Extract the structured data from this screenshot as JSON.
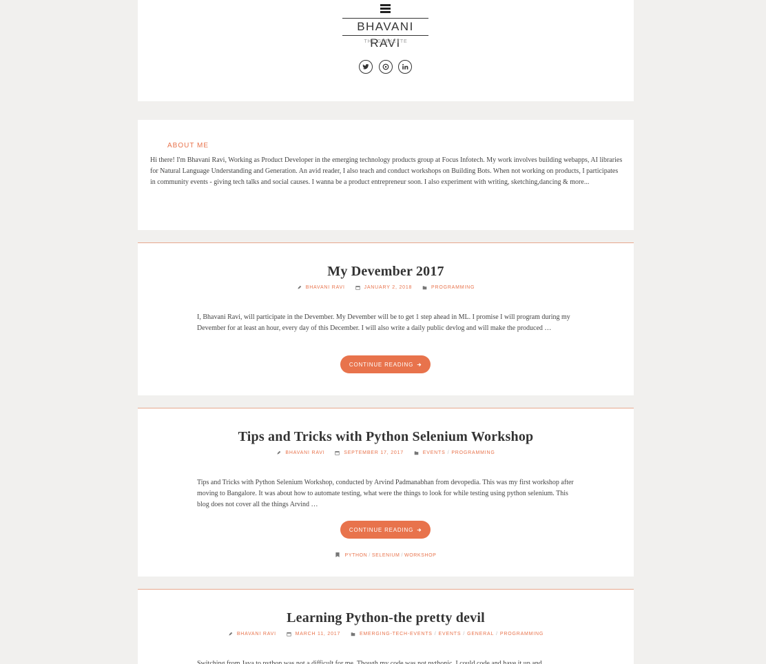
{
  "site": {
    "title": "BHAVANI RAVI",
    "tagline": "THE GEEKETTE",
    "social": [
      "twitter-icon",
      "dribbble-icon",
      "linkedin-icon"
    ]
  },
  "about": {
    "title": "ABOUT ME",
    "text": "Hi there! I'm Bhavani Ravi, Working as Product Developer in the emerging technology products group at Focus Infotech. My work involves building webapps, AI libraries for Natural Language Understanding and Generation. An avid reader, I also teach and conduct workshops on Building Bots. When not working on products, I participates in community events - giving tech talks and social causes. I wanna be a product entrepreneur soon. I also experiment with writing, sketching,dancing & more..."
  },
  "posts": [
    {
      "title": "My Devember 2017",
      "author": "BHAVANI RAVI",
      "date": "JANUARY 2, 2018",
      "categories": [
        "PROGRAMMING"
      ],
      "excerpt": "I, Bhavani Ravi, will participate in the Devember. My Devember will be to get 1 step ahead in ML. I promise I will program during my Devember for at least an hour, every day of this December. I will also write a daily public devlog and will make the produced …",
      "button": "CONTINUE READING"
    },
    {
      "title": "Tips and Tricks with Python Selenium Workshop",
      "author": "BHAVANI RAVI",
      "date": "SEPTEMBER 17, 2017",
      "categories": [
        "EVENTS",
        "PROGRAMMING"
      ],
      "excerpt": "Tips and Tricks with Python Selenium Workshop, conducted by Arvind Padmanabhan from devopedia. This was my first workshop after moving to Bangalore. It was about how to automate testing, what were the things to look for while testing using python selenium. This blog does not cover all the things Arvind …",
      "button": "CONTINUE READING",
      "tags": [
        "PYTHON",
        "SELENIUM",
        "WORKSHOP"
      ]
    },
    {
      "title": "Learning Python-the pretty devil",
      "author": "BHAVANI RAVI",
      "date": "MARCH 11, 2017",
      "categories": [
        "EMERGING-TECH-EVENTS",
        "EVENTS",
        "GENERAL",
        "PROGRAMMING"
      ],
      "excerpt": "Switching from Java to python was not a difficult for me. Though my code was not pythonic, I could code and have it up and"
    }
  ],
  "colors": {
    "accent": "#e8734c",
    "background": "#f1f0ee",
    "card": "#ffffff"
  }
}
